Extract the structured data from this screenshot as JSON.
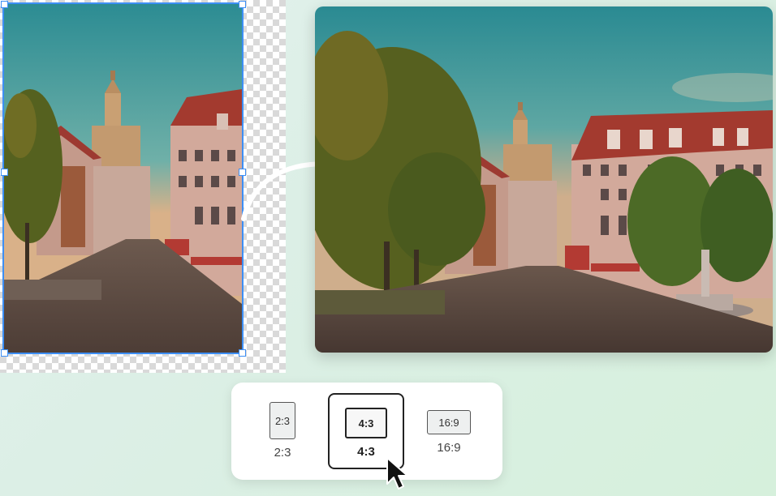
{
  "aspect_options": [
    {
      "box_label": "2:3",
      "label": "2:3"
    },
    {
      "box_label": "4:3",
      "label": "4:3"
    },
    {
      "box_label": "16:9",
      "label": "16:9"
    }
  ],
  "selected_option": "4:3",
  "colors": {
    "selection_outline": "#3d8ff5",
    "sky": "#3d8f94",
    "building": "#c9a092",
    "roof": "#a3392e",
    "foliage": "#4e5a1e"
  },
  "icons": [
    "resize-handle",
    "curved-arrow-icon",
    "mouse-pointer-icon"
  ]
}
